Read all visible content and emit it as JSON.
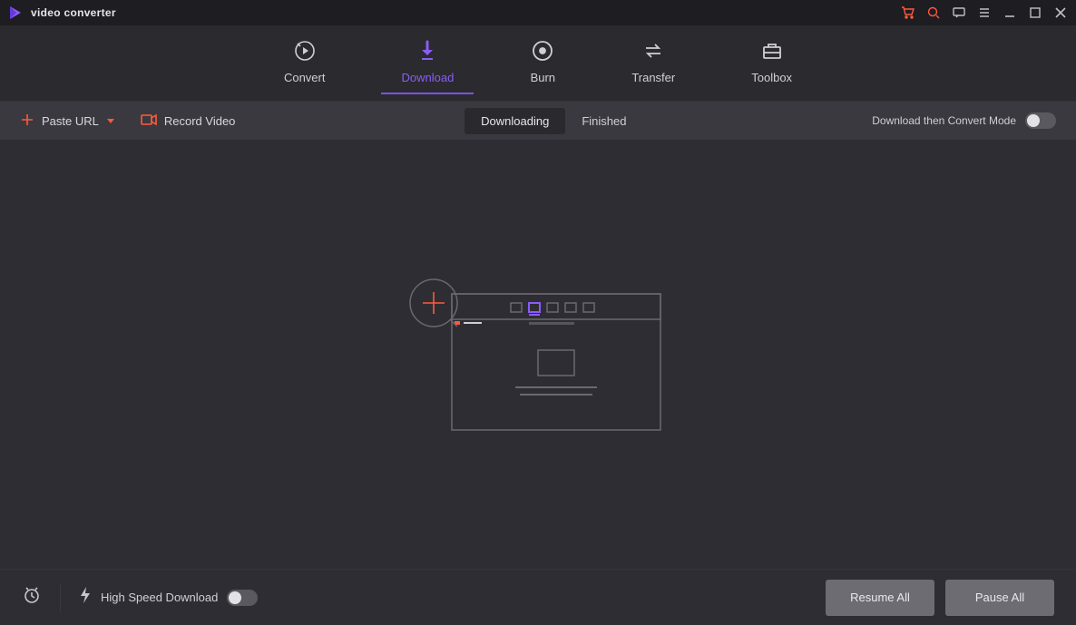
{
  "app": {
    "title": "video converter"
  },
  "nav": {
    "items": [
      {
        "label": "Convert"
      },
      {
        "label": "Download"
      },
      {
        "label": "Burn"
      },
      {
        "label": "Transfer"
      },
      {
        "label": "Toolbox"
      }
    ],
    "active_index": 1
  },
  "toolbar": {
    "paste_url_label": "Paste URL",
    "record_video_label": "Record Video",
    "tabs": {
      "downloading": "Downloading",
      "finished": "Finished",
      "active": "downloading"
    },
    "convert_mode_label": "Download then Convert Mode"
  },
  "footer": {
    "high_speed_label": "High Speed Download",
    "resume_label": "Resume All",
    "pause_label": "Pause All"
  },
  "colors": {
    "accent_purple": "#8b5cf6",
    "accent_orange": "#ff5a3c",
    "bg_dark": "#2b2a2f"
  }
}
